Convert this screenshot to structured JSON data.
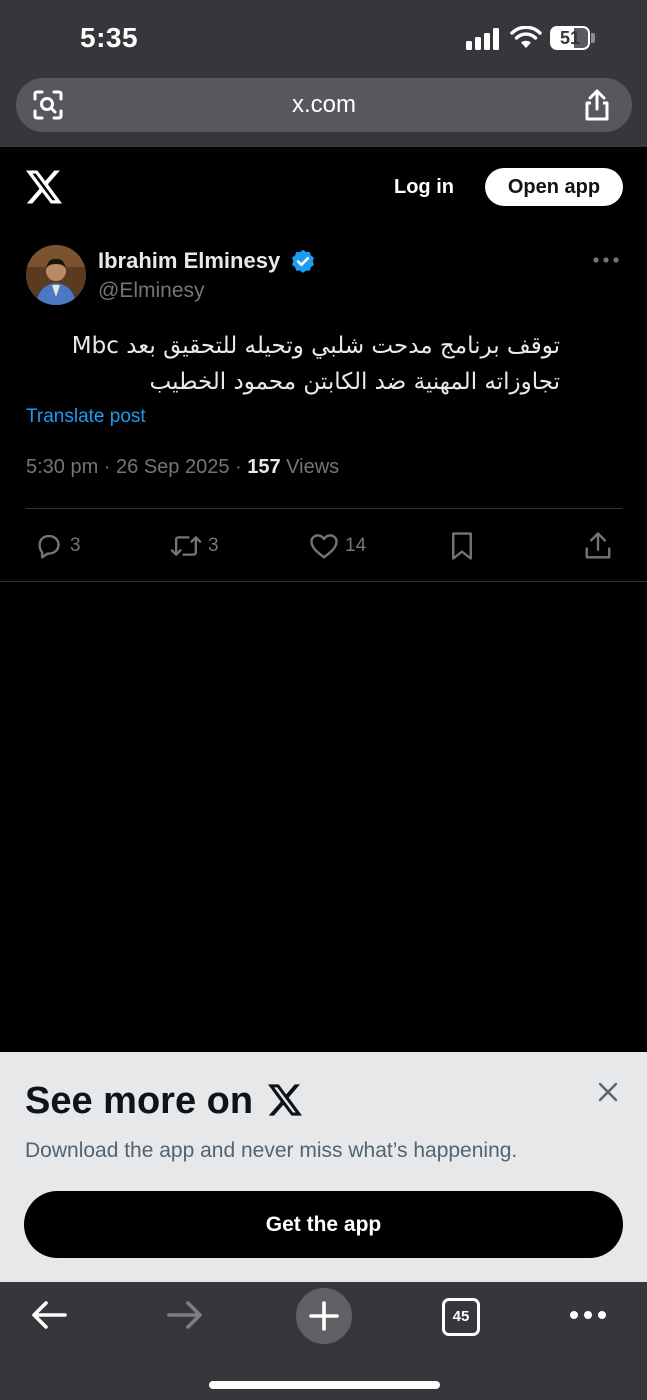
{
  "status_bar": {
    "time": "5:35",
    "battery": "51"
  },
  "browser": {
    "url": "x.com",
    "tab_count": "45"
  },
  "header": {
    "login_label": "Log in",
    "open_app_label": "Open app"
  },
  "post": {
    "author_name": "Ibrahim Elminesy",
    "author_handle": "@Elminesy",
    "text": "توقف برنامج مدحت شلبي وتحيله للتحقيق بعد Mbc تجاوزاته المهنية ضد الكابتن محمود الخطيب",
    "translate_label": "Translate post",
    "timestamp": "5:30 pm · 26 Sep 2025 · ",
    "views_count": "157",
    "views_label": " Views",
    "replies": "3",
    "reposts": "3",
    "likes": "14"
  },
  "promo": {
    "title": "See more on",
    "subtitle": "Download the app and never miss what’s happening.",
    "cta_label": "Get the app"
  },
  "colors": {
    "accent_blue": "#1d9bf0",
    "chrome_gray": "#35373a",
    "promo_bg": "#e6e8ea",
    "muted_text": "#71767b"
  },
  "icons": [
    "camera-search-icon",
    "share-icon",
    "x-logo-icon",
    "verified-badge-icon",
    "more-icon",
    "reply-icon",
    "repost-icon",
    "like-icon",
    "bookmark-icon",
    "close-icon",
    "back-arrow-icon",
    "forward-arrow-icon",
    "plus-icon",
    "tabs-icon",
    "ellipsis-icon"
  ]
}
